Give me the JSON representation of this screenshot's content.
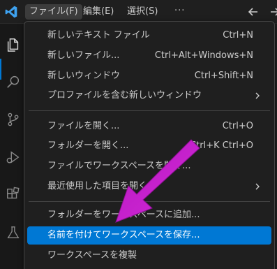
{
  "menubar": {
    "file": "ファイル(F)",
    "edit": "編集(E)",
    "select": "選択(S)",
    "more": "···"
  },
  "menu": {
    "items": [
      {
        "label": "新しいテキスト ファイル",
        "shortcut": "Ctrl+N"
      },
      {
        "label": "新しいファイル...",
        "shortcut": "Ctrl+Alt+Windows+N"
      },
      {
        "label": "新しいウィンドウ",
        "shortcut": "Ctrl+Shift+N"
      },
      {
        "label": "プロファイルを含む新しいウィンドウ",
        "shortcut": ""
      },
      {
        "label": "ファイルを開く...",
        "shortcut": "Ctrl+O"
      },
      {
        "label": "フォルダーを開く...",
        "shortcut": "Ctrl+K Ctrl+O"
      },
      {
        "label": "ファイルでワークスペースを開く...",
        "shortcut": ""
      },
      {
        "label": "最近使用した項目を開く",
        "shortcut": ""
      },
      {
        "label": "フォルダーをワークスペースに追加...",
        "shortcut": ""
      },
      {
        "label": "名前を付けてワークスペースを保存...",
        "shortcut": ""
      },
      {
        "label": "ワークスペースを複製",
        "shortcut": ""
      }
    ]
  },
  "colors": {
    "accent": "#0078d4",
    "annotation_arrow": "#c020c8",
    "menu_bg": "#1f1f1f"
  },
  "icons": [
    "vscode-logo",
    "arrow-left-icon",
    "arrow-right-icon",
    "explorer-icon",
    "search-icon",
    "source-control-icon",
    "run-debug-icon",
    "extensions-icon",
    "testing-icon",
    "chevron-right-icon"
  ]
}
